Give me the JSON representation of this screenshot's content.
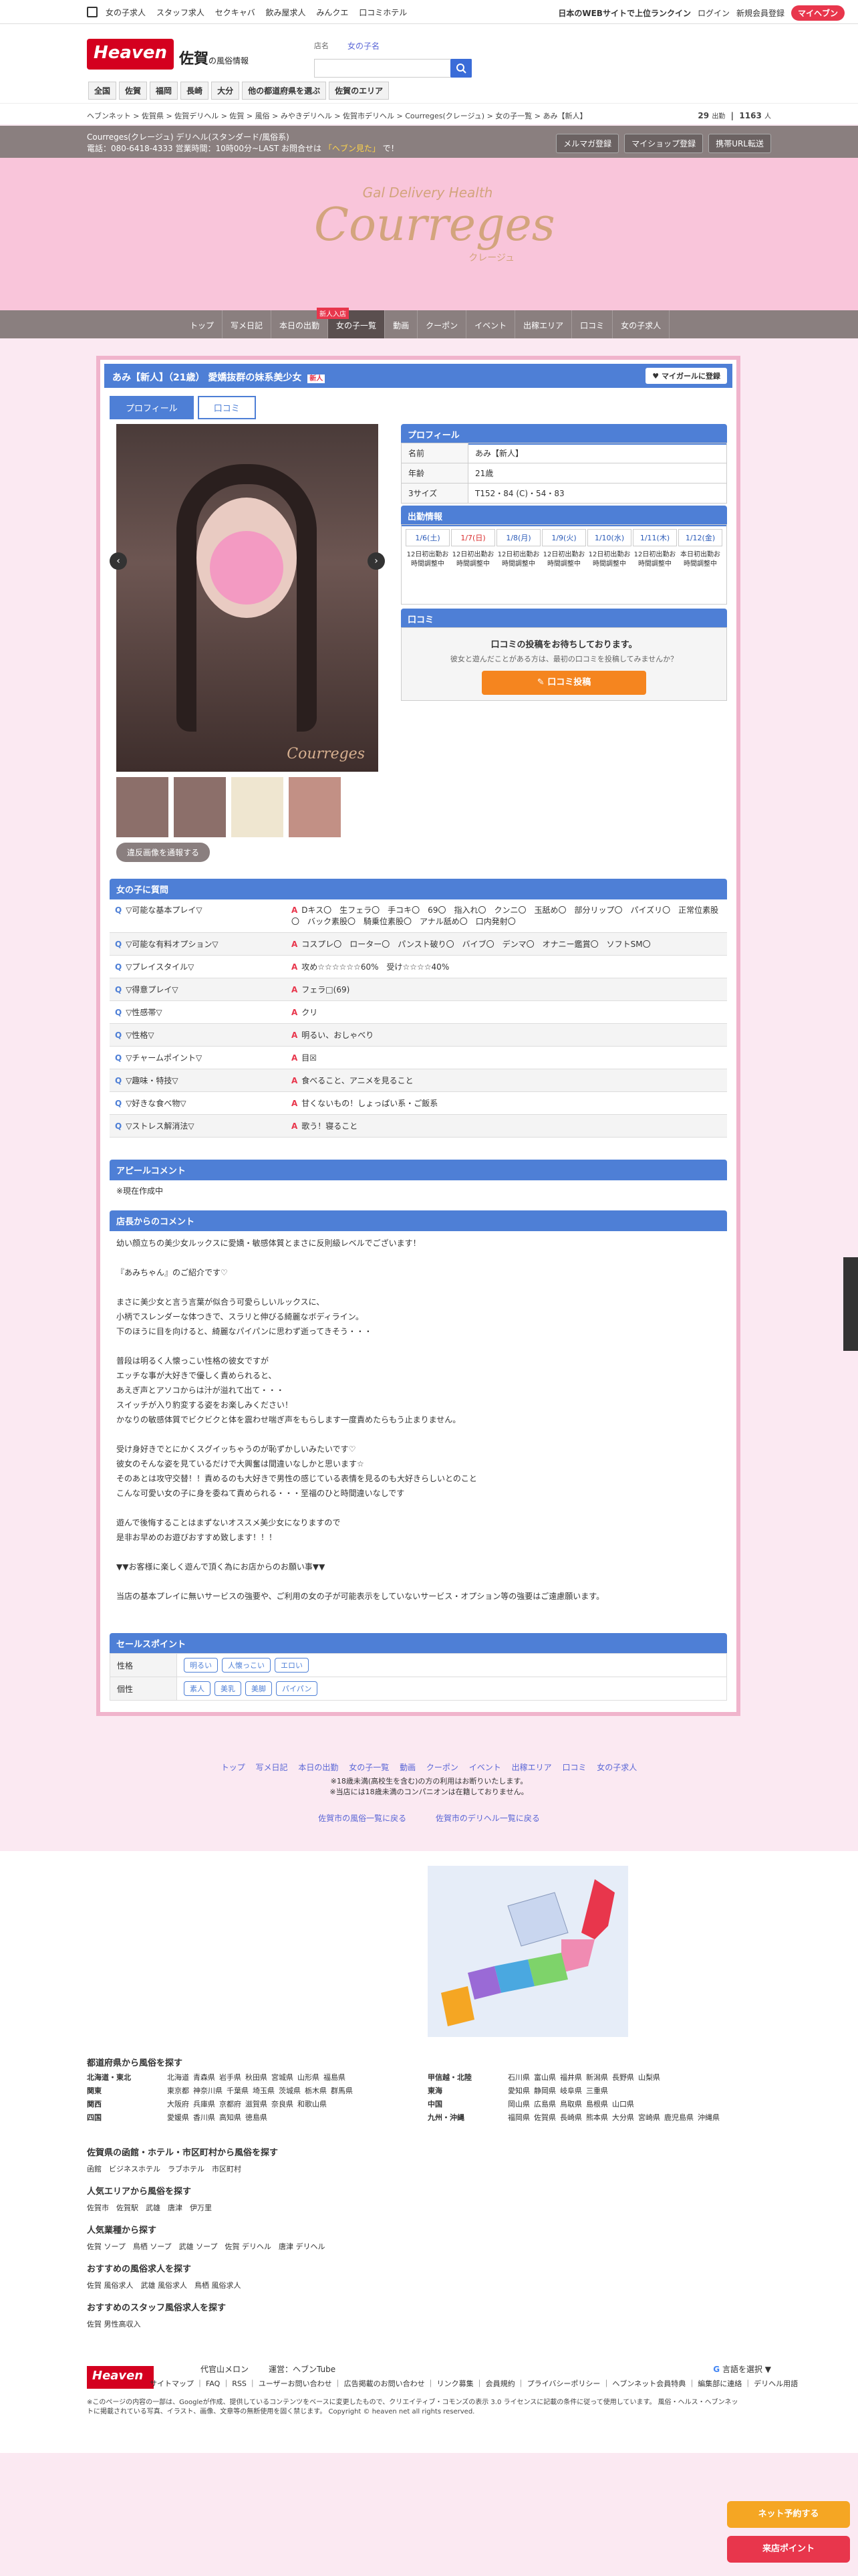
{
  "topbar": {
    "links": [
      "女の子求人",
      "スタッフ求人",
      "セクキャバ",
      "飲み屋求人",
      "みんクエ",
      "口コミホテル"
    ],
    "rank_text": "日本のWEBサイトで上位ランクイン",
    "login": "ログイン",
    "register": "新規会員登録",
    "my_heaven": "マイヘブン"
  },
  "header": {
    "logo": "Heaven",
    "region": "佐賀",
    "region_suffix": "の風俗情報",
    "search_label": "店名",
    "search_kw": "女の子名",
    "regions": [
      "全国",
      "佐賀",
      "福岡",
      "長崎",
      "大分",
      "他の都道府県を選ぶ",
      "佐賀のエリア"
    ]
  },
  "breadcrumb": {
    "text": "ヘブンネット > 佐賀県 > 佐賀デリヘル > 佐賀 > 風俗 > みやきデリヘル > 佐賀市デリヘル > Courreges(クレージュ) > 女の子一覧 > あみ【新人】",
    "count1": "29",
    "count1_unit": "出勤",
    "count2": "1163",
    "count2_unit": "人"
  },
  "shopbar": {
    "line1": "Courreges(クレージュ) デリヘル(スタンダード/風俗系)",
    "line2": "電話：080-6418-4333 営業時間：10時00分~LAST お問合せは",
    "line2_hl": "「ヘブン見た」",
    "line2_end": "で！",
    "buttons": [
      "メルマガ登録",
      "マイショップ登録",
      "携帯URL転送"
    ]
  },
  "banner": {
    "sub": "Gal Delivery Health",
    "main": "Courreges",
    "kana": "クレージュ"
  },
  "shop_nav": {
    "items": [
      "トップ",
      "写メ日記",
      "本日の出勤",
      "女の子一覧",
      "動画",
      "クーポン",
      "イベント",
      "出稼エリア",
      "口コミ",
      "女の子求人"
    ],
    "new_badge": "新人入店"
  },
  "girl": {
    "title": "あみ【新人】（21歳） 愛嬌抜群の妹系美少女",
    "title_badge": "新人",
    "fav_button": "マイガールに登録",
    "tabs": [
      "プロフィール",
      "口コミ"
    ],
    "report_button": "違反画像を通報する",
    "photo_sig": "Courreges"
  },
  "profile": {
    "heading": "プロフィール",
    "rows": [
      {
        "k": "名前",
        "v": "あみ【新人】"
      },
      {
        "k": "年齢",
        "v": "21歳"
      },
      {
        "k": "3サイズ",
        "v": "T152・84 (C)・54・83"
      }
    ]
  },
  "schedule": {
    "heading": "出勤情報",
    "dates": [
      "1/6(土)",
      "1/7(日)",
      "1/8(月)",
      "1/9(火)",
      "1/10(水)",
      "1/11(木)",
      "1/12(金)"
    ],
    "slots": [
      "12日初出勤お時間調整中",
      "12日初出勤お時間調整中",
      "12日初出勤お時間調整中",
      "12日初出勤お時間調整中",
      "12日初出勤お時間調整中",
      "12日初出勤お時間調整中",
      "本日初出勤お時間調整中"
    ]
  },
  "review": {
    "heading": "口コミ",
    "line1": "口コミの投稿をお待ちしております。",
    "line2": "彼女と遊んだことがある方は、最初の口コミを投稿してみませんか？",
    "button": "口コミ投稿"
  },
  "qa": {
    "heading": "女の子に質問",
    "rows": [
      {
        "q": "▽可能な基本プレイ▽",
        "a": "Dキス〇　生フェラ〇　手コキ〇　69〇　指入れ〇　クンニ〇　玉舐め〇　部分リップ〇　パイズリ〇　正常位素股〇　バック素股〇　騎乗位素股〇　アナル舐め〇　口内発射〇"
      },
      {
        "q": "▽可能な有料オプション▽",
        "a": "コスプレ〇　ローター〇　パンスト破り〇　バイブ〇　デンマ〇　オナニー鑑賞〇　ソフトSM〇"
      },
      {
        "q": "▽プレイスタイル▽",
        "a": "攻め☆☆☆☆☆☆60%　受け☆☆☆☆40%"
      },
      {
        "q": "▽得意プレイ▽",
        "a": "フェラ□(69)"
      },
      {
        "q": "▽性感帯▽",
        "a": "クリ"
      },
      {
        "q": "▽性格▽",
        "a": "明るい、おしゃべり"
      },
      {
        "q": "▽チャームポイント▽",
        "a": "目☒"
      },
      {
        "q": "▽趣味・特技▽",
        "a": "食べること、アニメを見ること"
      },
      {
        "q": "▽好きな食べ物▽",
        "a": "甘くないもの！しょっぱい系・ご飯系"
      },
      {
        "q": "▽ストレス解消法▽",
        "a": "歌う！寝ること"
      }
    ]
  },
  "appeal": {
    "heading": "アピールコメント",
    "text": "※現在作成中"
  },
  "comment": {
    "heading": "店長からのコメント",
    "lines": [
      "幼い顔立ちの美少女ルックスに愛嬌・敏感体質とまさに反則級レベルでございます！",
      "",
      "『あみちゃん』のご紹介です♡",
      "",
      "まさに美少女と言う言葉が似合う可愛らしいルックスに、",
      "小柄でスレンダーな体つきで、スラリと伸びる綺麗なボディライン。",
      "下のほうに目を向けると、綺麗なパイパンに思わず逝ってきそう・・・",
      "",
      "普段は明るく人懐っこい性格の彼女ですが",
      "エッチな事が大好きで優しく責められると、",
      "あえぎ声とアソコからは汁が溢れて出て・・・",
      "スイッチが入り豹変する姿をお楽しみください！",
      "かなりの敏感体質でビクビクと体を震わせ喘ぎ声をもらします一度責めたらもう止まりません。",
      "",
      "受け身好きでとにかくスグイッちゃうのが恥ずかしいみたいです♡",
      "彼女のそんな姿を見ているだけで大興奮は間違いなしかと思います☆",
      "そのあとは攻守交替！！責めるのも大好きで男性の感じている表情を見るのも大好きらしいとのこと",
      "こんな可愛い女の子に身を委ねて責められる・・・至福のひと時間違いなしです",
      "",
      "遊んで後悔することはまずないオススメ美少女になりますので",
      "是非お早めのお遊びおすすめ致します！！！",
      "",
      "▼▼お客様に楽しく遊んで頂く為にお店からのお願い事▼▼",
      "",
      "当店の基本プレイに無いサービスの強要や、ご利用の女の子が可能表示をしていないサービス・オプション等の強要はご遠慮願います。"
    ]
  },
  "sales": {
    "heading": "セールスポイント",
    "rows": [
      {
        "k": "性格",
        "tags": [
          "明るい",
          "人懐っこい",
          "エロい"
        ]
      },
      {
        "k": "個性",
        "tags": [
          "素人",
          "美乳",
          "美脚",
          "パイパン"
        ]
      }
    ]
  },
  "footer": {
    "nav": [
      "トップ",
      "写メ日記",
      "本日の出勤",
      "女の子一覧",
      "動画",
      "クーポン",
      "イベント",
      "出稼エリア",
      "口コミ",
      "女の子求人"
    ],
    "note1": "※18歳未満(高校生を含む)の方の利用はお断りいたします。",
    "note2": "※当店には18歳未満のコンパニオンは在籍しておりません。",
    "links": [
      "佐賀市の風俗一覧に戻る",
      "佐賀市のデリヘル一覧に戻る"
    ]
  },
  "areas": {
    "title": "都道府県から風俗を探す",
    "rows": [
      {
        "r": "北海道・東北",
        "p": [
          "北海道",
          "青森県",
          "岩手県",
          "秋田県",
          "宮城県",
          "山形県",
          "福島県"
        ],
        "r2": "甲信越・北陸",
        "p2": [
          "石川県",
          "富山県",
          "福井県",
          "新潟県",
          "長野県",
          "山梨県"
        ]
      },
      {
        "r": "関東",
        "p": [
          "東京都",
          "神奈川県",
          "千葉県",
          "埼玉県",
          "茨城県",
          "栃木県",
          "群馬県"
        ],
        "r2": "東海",
        "p2": [
          "愛知県",
          "静岡県",
          "岐阜県",
          "三重県"
        ]
      },
      {
        "r": "関西",
        "p": [
          "大阪府",
          "兵庫県",
          "京都府",
          "滋賀県",
          "奈良県",
          "和歌山県"
        ],
        "r2": "中国",
        "p2": [
          "岡山県",
          "広島県",
          "鳥取県",
          "島根県",
          "山口県"
        ]
      },
      {
        "r": "四国",
        "p": [
          "愛媛県",
          "香川県",
          "高知県",
          "徳島県"
        ],
        "r2": "九州・沖縄",
        "p2": [
          "福岡県",
          "佐賀県",
          "長崎県",
          "熊本県",
          "大分県",
          "宮崎県",
          "鹿児島県",
          "沖縄県"
        ]
      }
    ],
    "blocks": [
      {
        "h": "佐賀県の函館・ホテル・市区町村から風俗を探す",
        "v": "函館　ビジネスホテル　ラブホテル　市区町村"
      },
      {
        "h": "人気エリアから風俗を探す",
        "v": "佐賀市　佐賀駅　武雄　唐津　伊万里"
      },
      {
        "h": "人気業種から探す",
        "v": "佐賀 ソープ　鳥栖 ソープ　武雄 ソープ　佐賀 デリヘル　唐津 デリヘル"
      },
      {
        "h": "おすすめの風俗求人を探す",
        "v": "佐賀 風俗求人　武雄 風俗求人　鳥栖 風俗求人"
      },
      {
        "h": "おすすめのスタッフ風俗求人を探す",
        "v": "佐賀 男性高収入"
      }
    ]
  },
  "bottom": {
    "row1": [
      "代官山メロン",
      "運営：ヘブンTube"
    ],
    "row2": "サイトマップ ｜ FAQ ｜ RSS ｜ ユーザーお問い合わせ ｜ 広告掲載のお問い合わせ ｜ リンク募集 ｜ 会員規約 ｜ プライバシーポリシー ｜ ヘブンネット会員特典 ｜ 編集部に連絡 ｜ デリヘル用語",
    "row3": "※このページの内容の一部は、Googleが作成、提供しているコンテンツをベースに変更したもので、クリエイティブ・コモンズの表示 3.0 ライセンスに記載の条件に従って使用しています。 風俗・ヘルス・ヘブンネットに掲載されている写真、イラスト、画像、文章等の無断使用を固く禁じます。 Copyright © heaven net all rights reserved.",
    "lang": "言語を選択"
  },
  "floats": {
    "net_reserve": "ネット予約する",
    "shop_point": "来店ポイント"
  },
  "colors": {
    "accent": "#4e7fd6",
    "pink_bg": "#fbe9f2",
    "banner": "#f9c5da",
    "brand_red": "#d4001f"
  }
}
